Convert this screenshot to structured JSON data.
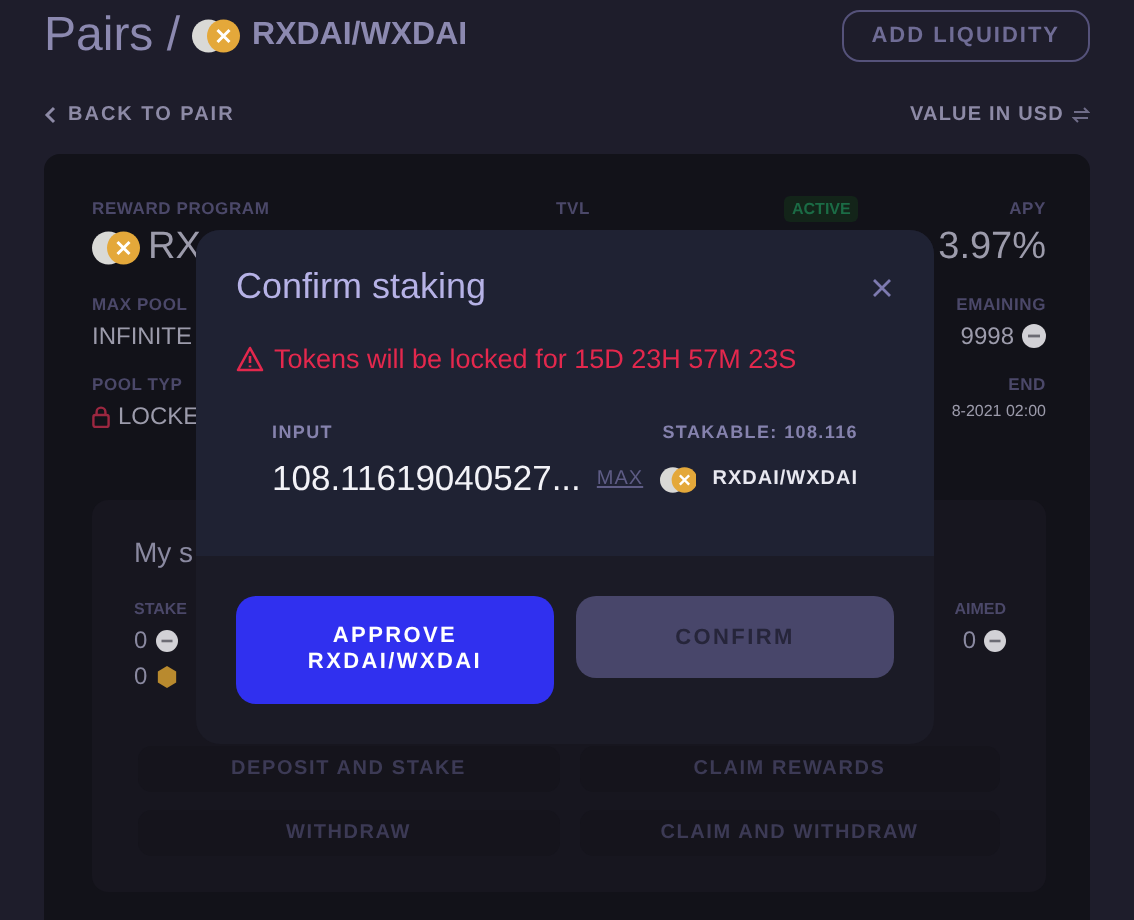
{
  "header": {
    "title": "Pairs /",
    "pair": "RXDAI/WXDAI",
    "add_liquidity": "ADD LIQUIDITY"
  },
  "nav": {
    "back": "BACK TO PAIR",
    "value_toggle": "VALUE IN USD"
  },
  "program": {
    "reward_label": "REWARD PROGRAM",
    "reward_value": "RX",
    "tvl_label": "TVL",
    "status": "ACTIVE",
    "apy_label": "APY",
    "apy_value": "3.97%",
    "max_pool_label": "MAX POOL",
    "max_pool_value": "INFINITE",
    "remaining_label": "EMAINING",
    "remaining_value": "9998",
    "pool_type_label": "POOL TYP",
    "pool_type_value": "LOCKE",
    "end_label": "END",
    "end_value": "8-2021 02:00"
  },
  "my_stake": {
    "title": "My s",
    "staked_label": "STAKE",
    "staked": [
      {
        "value": "0",
        "kind": "grey"
      },
      {
        "value": "0",
        "kind": "gold"
      }
    ],
    "claimed_label": "AIMED",
    "claimed": [
      {
        "value": "0",
        "kind": "grey"
      }
    ]
  },
  "actions": [
    {
      "label": "DEPOSIT AND STAKE"
    },
    {
      "label": "CLAIM REWARDS"
    },
    {
      "label": "WITHDRAW"
    },
    {
      "label": "CLAIM AND WITHDRAW"
    }
  ],
  "modal": {
    "title": "Confirm staking",
    "warning": "Tokens will be locked for 15D 23H 57M 23S",
    "input_label": "INPUT",
    "stakable": "STAKABLE: 108.116",
    "value": "108.11619040527...",
    "max": "MAX",
    "token": "RXDAI/WXDAI",
    "approve": "APPROVE RXDAI/WXDAI",
    "confirm": "CONFIRM",
    "confirm_disabled": true
  }
}
